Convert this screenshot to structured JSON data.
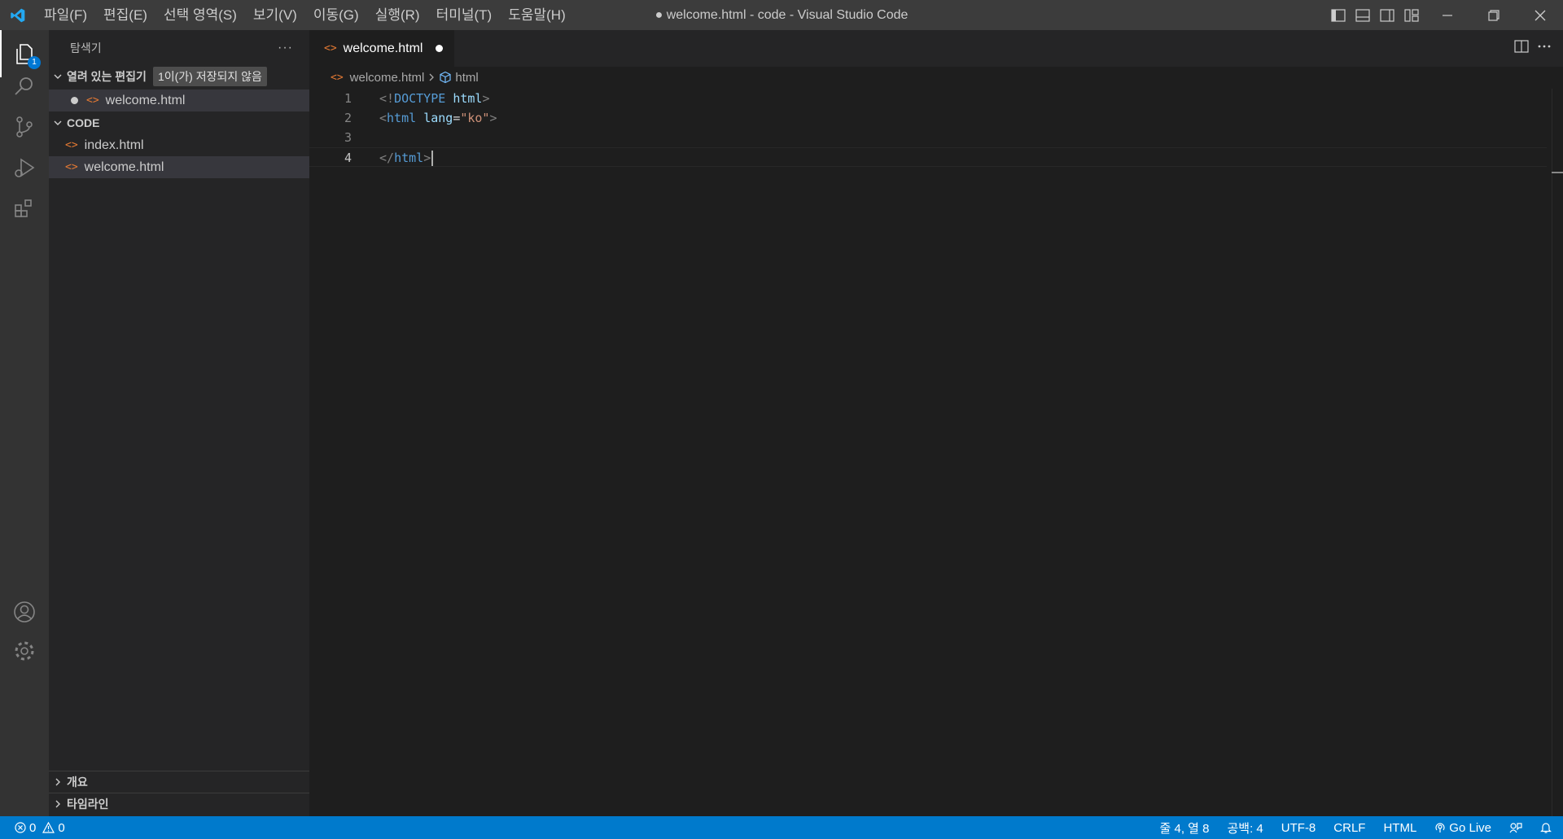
{
  "window_title": "● welcome.html - code - Visual Studio Code",
  "menu": [
    "파일(F)",
    "편집(E)",
    "선택 영역(S)",
    "보기(V)",
    "이동(G)",
    "실행(R)",
    "터미널(T)",
    "도움말(H)"
  ],
  "activity": {
    "explorer_badge": "1"
  },
  "sidebar": {
    "title": "탐색기",
    "more": "···",
    "open_editors": {
      "label": "열려 있는 편집기",
      "badge": "1이(가) 저장되지 않음",
      "files": [
        "welcome.html"
      ]
    },
    "workspace": {
      "label": "CODE",
      "files": [
        "index.html",
        "welcome.html"
      ]
    },
    "outline": "개요",
    "timeline": "타임라인"
  },
  "tab": {
    "label": "welcome.html"
  },
  "breadcrumb": {
    "file": "welcome.html",
    "symbol": "html"
  },
  "code": {
    "line_numbers": [
      "1",
      "2",
      "3",
      "4"
    ],
    "l1_open": "<!",
    "l1_doctype": "DOCTYPE",
    "l1_sp": " ",
    "l1_html": "html",
    "l1_close": ">",
    "l2_open": "<",
    "l2_tag": "html",
    "l2_sp": " ",
    "l2_attr": "lang",
    "l2_eq": "=",
    "l2_val": "\"ko\"",
    "l2_close": ">",
    "l4_open": "</",
    "l4_tag": "html",
    "l4_close": ">"
  },
  "status": {
    "errors": "0",
    "warnings": "0",
    "position": "줄 4, 열 8",
    "spaces": "공백: 4",
    "encoding": "UTF-8",
    "eol": "CRLF",
    "language": "HTML",
    "golive": "Go Live"
  },
  "colors": {
    "statusbar": "#007acc",
    "accent": "#0078d4",
    "html_icon": "#e37933"
  }
}
